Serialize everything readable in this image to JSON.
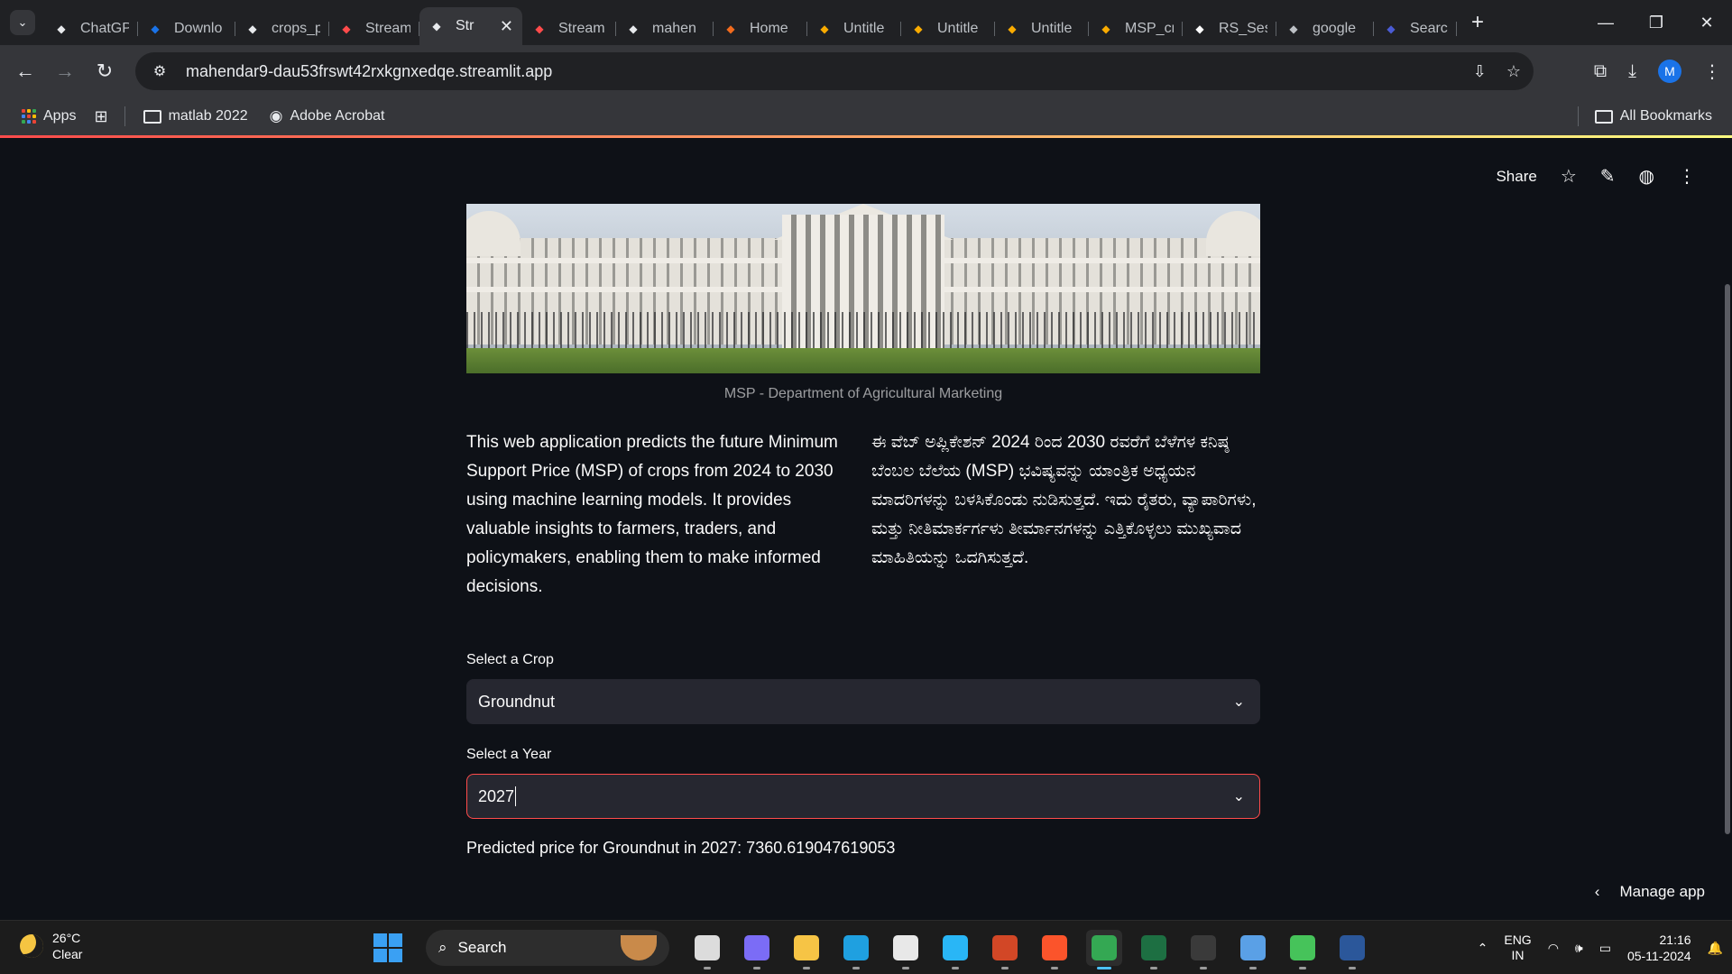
{
  "browser": {
    "tabs": [
      {
        "title": "ChatGP",
        "icon": "chatgpt-icon",
        "color": "#e8eaed"
      },
      {
        "title": "Downlo",
        "icon": "n-icon",
        "color": "#1a73e8"
      },
      {
        "title": "crops_p",
        "icon": "streamlit-icon",
        "color": "#e8eaed"
      },
      {
        "title": "Stream",
        "icon": "streamlit-icon",
        "color": "#ff4b4b"
      },
      {
        "title": "Str",
        "icon": "streamlit-icon",
        "color": "#e8eaed",
        "active": true
      },
      {
        "title": "Stream",
        "icon": "streamlit-icon",
        "color": "#ff4b4b"
      },
      {
        "title": "mahen",
        "icon": "github-icon",
        "color": "#e8eaed"
      },
      {
        "title": "Home",
        "icon": "home-icon",
        "color": "#f26b1d"
      },
      {
        "title": "Untitle",
        "icon": "colab-icon",
        "color": "#f9ab00"
      },
      {
        "title": "Untitle",
        "icon": "colab-icon",
        "color": "#f9ab00"
      },
      {
        "title": "Untitle",
        "icon": "colab-icon",
        "color": "#f9ab00"
      },
      {
        "title": "MSP_cr",
        "icon": "colab-icon",
        "color": "#f9ab00"
      },
      {
        "title": "RS_Ses",
        "icon": "google-icon",
        "color": "#ffffff"
      },
      {
        "title": "google",
        "icon": "globe-icon",
        "color": "#bdc1c6"
      },
      {
        "title": "Search",
        "icon": "search-app-icon",
        "color": "#4a5bd4"
      }
    ],
    "url": "mahendar9-dau53frswt42rxkgnxedqe.streamlit.app",
    "avatar_letter": "M",
    "bookmarks": [
      {
        "label": "Apps",
        "icon": "apps-grid-icon"
      },
      {
        "label": "",
        "icon": "tab-groups-icon"
      },
      {
        "label": "matlab 2022",
        "icon": "folder-icon"
      },
      {
        "label": "Adobe Acrobat",
        "icon": "globe-icon"
      }
    ],
    "all_bookmarks": "All Bookmarks"
  },
  "streamlit": {
    "share": "Share",
    "manage_app": "Manage app"
  },
  "page": {
    "caption": "MSP - Department of Agricultural Marketing",
    "description_en": "This web application predicts the future Minimum Support Price (MSP) of crops from 2024 to 2030 using machine learning models. It provides valuable insights to farmers, traders, and policymakers, enabling them to make informed decisions.",
    "description_kn": "ಈ ವೆಬ್ ಅಪ್ಲಿಕೇಶನ್ 2024 ರಿಂದ 2030 ರವರೆಗೆ ಬೆಳೆಗಳ ಕನಿಷ್ಠ ಬೆಂಬಲ ಬೆಲೆಯ (MSP) ಭವಿಷ್ಯವನ್ನು ಯಾಂತ್ರಿಕ ಅಧ್ಯಯನ ಮಾದರಿಗಳನ್ನು ಬಳಸಿಕೊಂಡು ನುಡಿಸುತ್ತದೆ. ಇದು ರೈತರು, ವ್ಯಾಪಾರಿಗಳು, ಮತ್ತು ನೀತಿಮಾರ್ಕರ್ಗಳು ತೀರ್ಮಾನಗಳನ್ನು ಎತ್ತಿಕೊಳ್ಳಲು ಮುಖ್ಯವಾದ ಮಾಹಿತಿಯನ್ನು ಒದಗಿಸುತ್ತದೆ.",
    "crop_label": "Select a Crop",
    "crop_value": "Groundnut",
    "year_label": "Select a Year",
    "year_value": "2027",
    "result": "Predicted price for Groundnut in 2027: 7360.619047619053"
  },
  "taskbar": {
    "temperature": "26°C",
    "condition": "Clear",
    "search": "Search",
    "apps": [
      {
        "name": "task-view",
        "icon": "task-view-icon",
        "color": "#dcdcdc"
      },
      {
        "name": "copilot",
        "icon": "copilot-icon",
        "color": "#7b6cf6"
      },
      {
        "name": "file-explorer",
        "icon": "folder-icon",
        "color": "#f6c445"
      },
      {
        "name": "edge",
        "icon": "edge-icon",
        "color": "#1fa0e0"
      },
      {
        "name": "store",
        "icon": "store-icon",
        "color": "#e8e8e8"
      },
      {
        "name": "cortana",
        "icon": "circle-app-icon",
        "color": "#29b6f6"
      },
      {
        "name": "powerpoint",
        "icon": "powerpoint-icon",
        "color": "#d24726"
      },
      {
        "name": "brave",
        "icon": "brave-icon",
        "color": "#fb542b"
      },
      {
        "name": "chrome",
        "icon": "chrome-icon",
        "color": "#34a853",
        "active": true
      },
      {
        "name": "excel",
        "icon": "excel-icon",
        "color": "#1d6f42"
      },
      {
        "name": "terminal",
        "icon": "terminal-icon",
        "color": "#3a3a3a"
      },
      {
        "name": "notepad",
        "icon": "notepad-icon",
        "color": "#5aa0e6"
      },
      {
        "name": "progress-app",
        "icon": "ring-icon",
        "color": "#46c35a"
      },
      {
        "name": "word",
        "icon": "word-icon",
        "color": "#2b579a"
      }
    ],
    "lang": "ENG",
    "region": "IN",
    "time": "21:16",
    "date": "05-11-2024"
  }
}
